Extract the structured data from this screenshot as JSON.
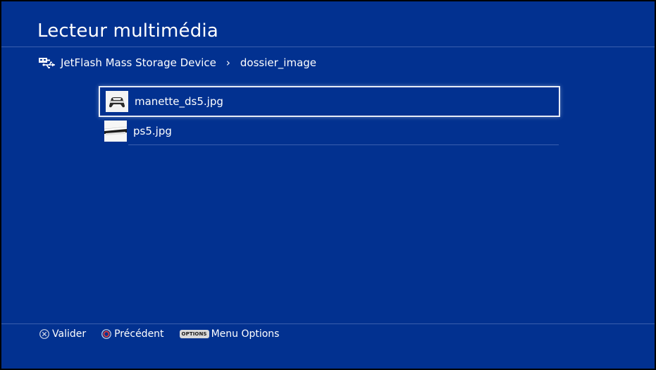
{
  "header": {
    "title": "Lecteur multimédia"
  },
  "breadcrumb": {
    "device_icon": "usb-icon",
    "device": "JetFlash Mass Storage Device",
    "separator": "›",
    "folder": "dossier_image"
  },
  "files": [
    {
      "name": "manette_ds5.jpg",
      "thumbnail": "controller-thumbnail",
      "selected": true
    },
    {
      "name": "ps5.jpg",
      "thumbnail": "console-thumbnail",
      "selected": false
    }
  ],
  "footer": {
    "confirm": {
      "icon": "cross-button-icon",
      "label": "Valider"
    },
    "back": {
      "icon": "circle-button-icon",
      "label": "Précédent"
    },
    "options": {
      "badge": "OPTIONS",
      "label": "Menu Options"
    }
  },
  "colors": {
    "background": "#023190",
    "divider": "#3a5fae",
    "text": "#ffffff",
    "selection_border": "#e8ecf6",
    "circle_button": "#e03a3a"
  }
}
